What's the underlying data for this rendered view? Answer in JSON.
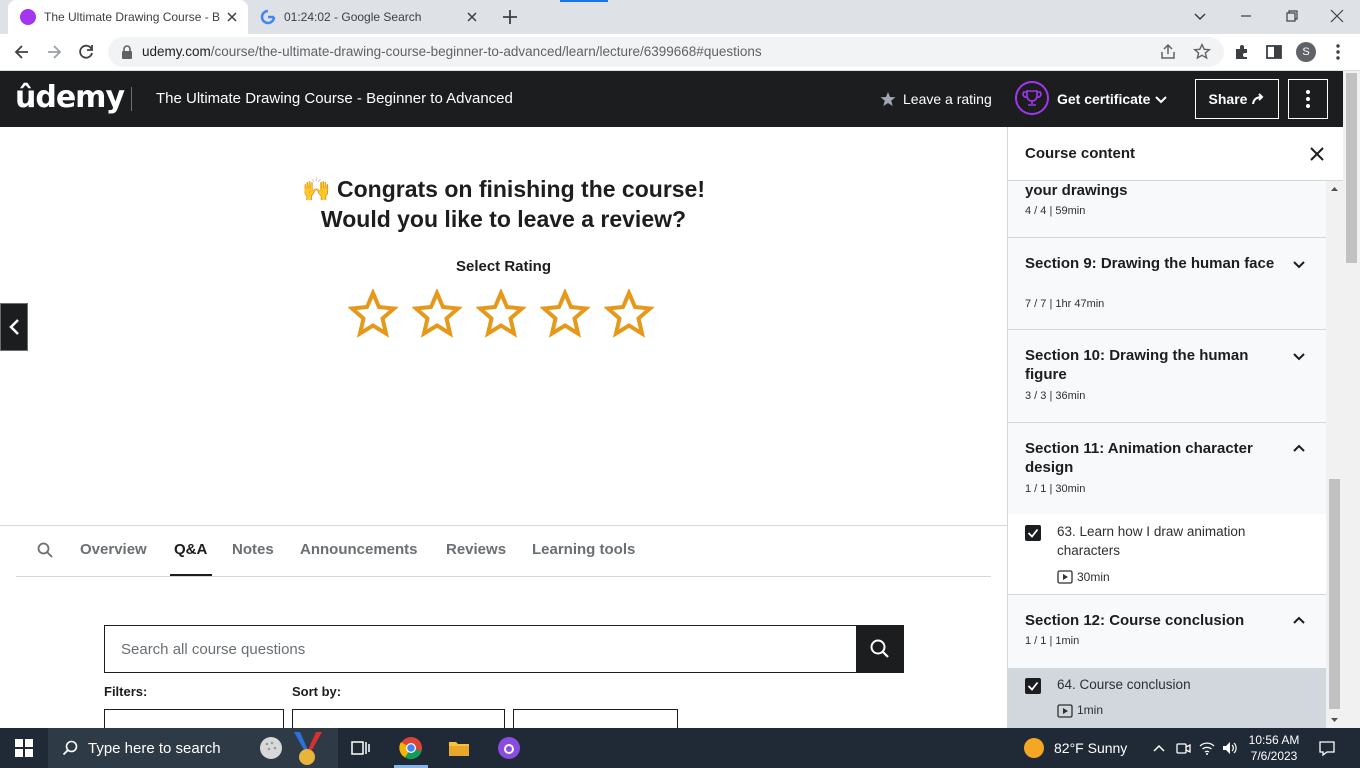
{
  "browser": {
    "tabs": [
      {
        "title": "The Ultimate Drawing Course - B",
        "favicon": "udemy-favicon",
        "active": true
      },
      {
        "title": "01:24:02 - Google Search",
        "favicon": "google-favicon",
        "active": false
      }
    ],
    "url_domain": "udemy.com",
    "url_path": "/course/the-ultimate-drawing-course-beginner-to-advanced/learn/lecture/6399668#questions",
    "profile_initial": "S"
  },
  "header": {
    "logo": "ûdemy",
    "course_title": "The Ultimate Drawing Course - Beginner to Advanced",
    "leave_rating": "Leave a rating",
    "get_certificate": "Get certificate",
    "share": "Share"
  },
  "main": {
    "congrats_emoji": "🙌",
    "congrats_line1": "Congrats on finishing the course!",
    "congrats_line2": "Would you like to leave a review?",
    "select_rating": "Select Rating",
    "stars": 5,
    "star_color": "#e59819",
    "tabs": [
      {
        "label": "Overview"
      },
      {
        "label": "Q&A"
      },
      {
        "label": "Notes"
      },
      {
        "label": "Announcements"
      },
      {
        "label": "Reviews"
      },
      {
        "label": "Learning tools"
      }
    ],
    "selected_tab": "Q&A",
    "search_placeholder": "Search all course questions",
    "filters_label": "Filters:",
    "sort_label": "Sort by:"
  },
  "sidebar": {
    "title": "Course content",
    "sections": [
      {
        "name": "your drawings",
        "meta": "4 / 4 | 59min"
      },
      {
        "name": "Section 9: Drawing the human face",
        "meta": "7 / 7 | 1hr 47min",
        "expanded": false
      },
      {
        "name": "Section 10: Drawing the human figure",
        "meta": "3 / 3 | 36min",
        "expanded": false
      },
      {
        "name": "Section 11: Animation character design",
        "meta": "1 / 1 | 30min",
        "expanded": true
      },
      {
        "name": "Section 12: Course conclusion",
        "meta": "1 / 1 | 1min",
        "expanded": true
      }
    ],
    "lectures": [
      {
        "name": "63. Learn how I draw animation characters",
        "duration": "30min",
        "completed": true
      },
      {
        "name": "64. Course conclusion",
        "duration": "1min",
        "completed": true,
        "current": true
      }
    ]
  },
  "taskbar": {
    "search_placeholder": "Type here to search",
    "weather": "82°F  Sunny",
    "time": "10:56 AM",
    "date": "7/6/2023"
  },
  "colors": {
    "udemy_dark": "#1c1d1f",
    "udemy_purple": "#a435f0",
    "taskbar": "#1f2a36"
  }
}
